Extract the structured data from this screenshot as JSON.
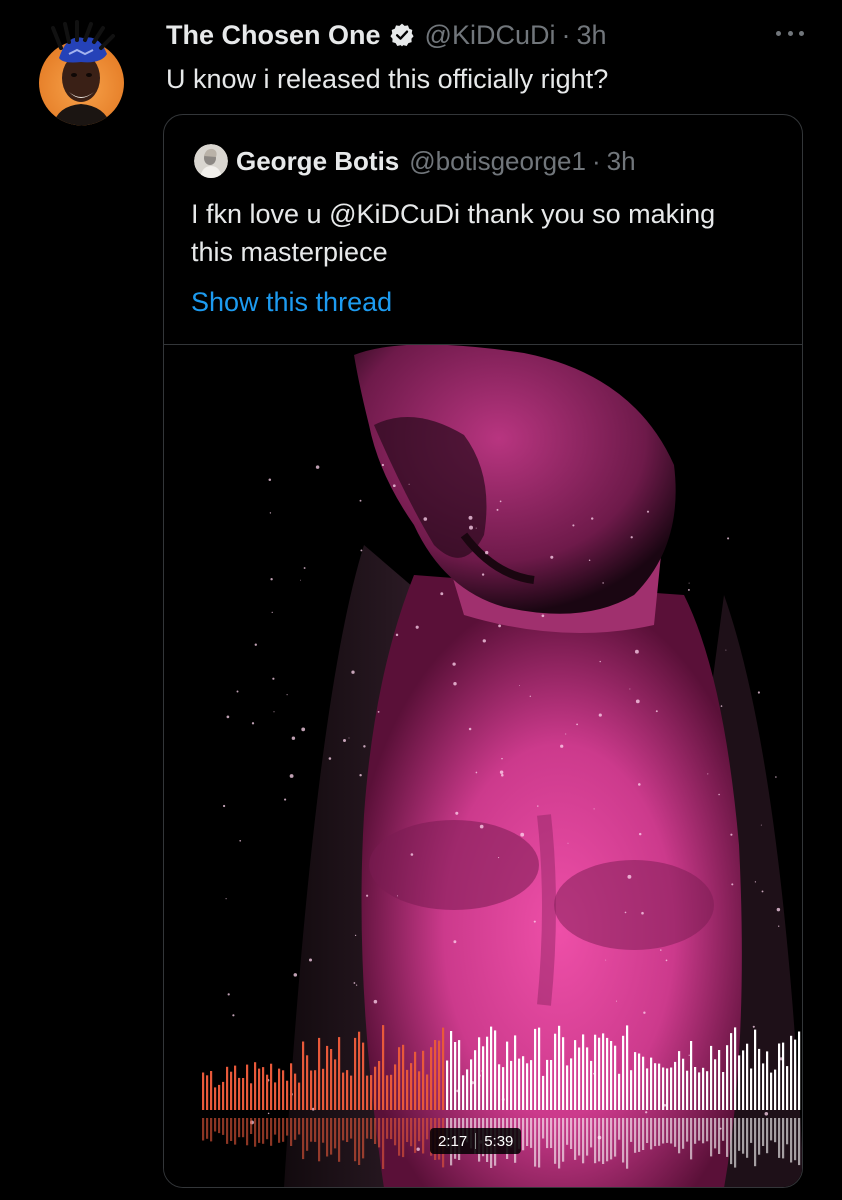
{
  "tweet": {
    "author_name": "The Chosen One",
    "verified": true,
    "handle": "@KiDCuDi",
    "separator": "·",
    "time": "3h",
    "text": "U know i released this officially right?"
  },
  "quoted_tweet": {
    "author_name": "George Botis",
    "handle": "@botisgeorge1",
    "separator": "·",
    "time": "3h",
    "text_before": "I fkn love u ",
    "mention": "@KiDCuDi",
    "text_after": " thank you so making this masterpiece",
    "show_thread": "Show this thread",
    "audio": {
      "elapsed": "2:17",
      "duration": "5:39",
      "progress": 0.405
    }
  },
  "colors": {
    "background": "#000000",
    "text_primary": "#e7e9ea",
    "text_secondary": "#71767b",
    "link": "#1d9bf0",
    "verified_badge": "#e7e9ea",
    "waveform_played": "#e8593a",
    "waveform_unplayed": "#ffffff",
    "artwork_tint": "#d23a8c"
  },
  "icons": {
    "verified": "verified-badge-icon",
    "more": "more-horizontal-icon"
  }
}
